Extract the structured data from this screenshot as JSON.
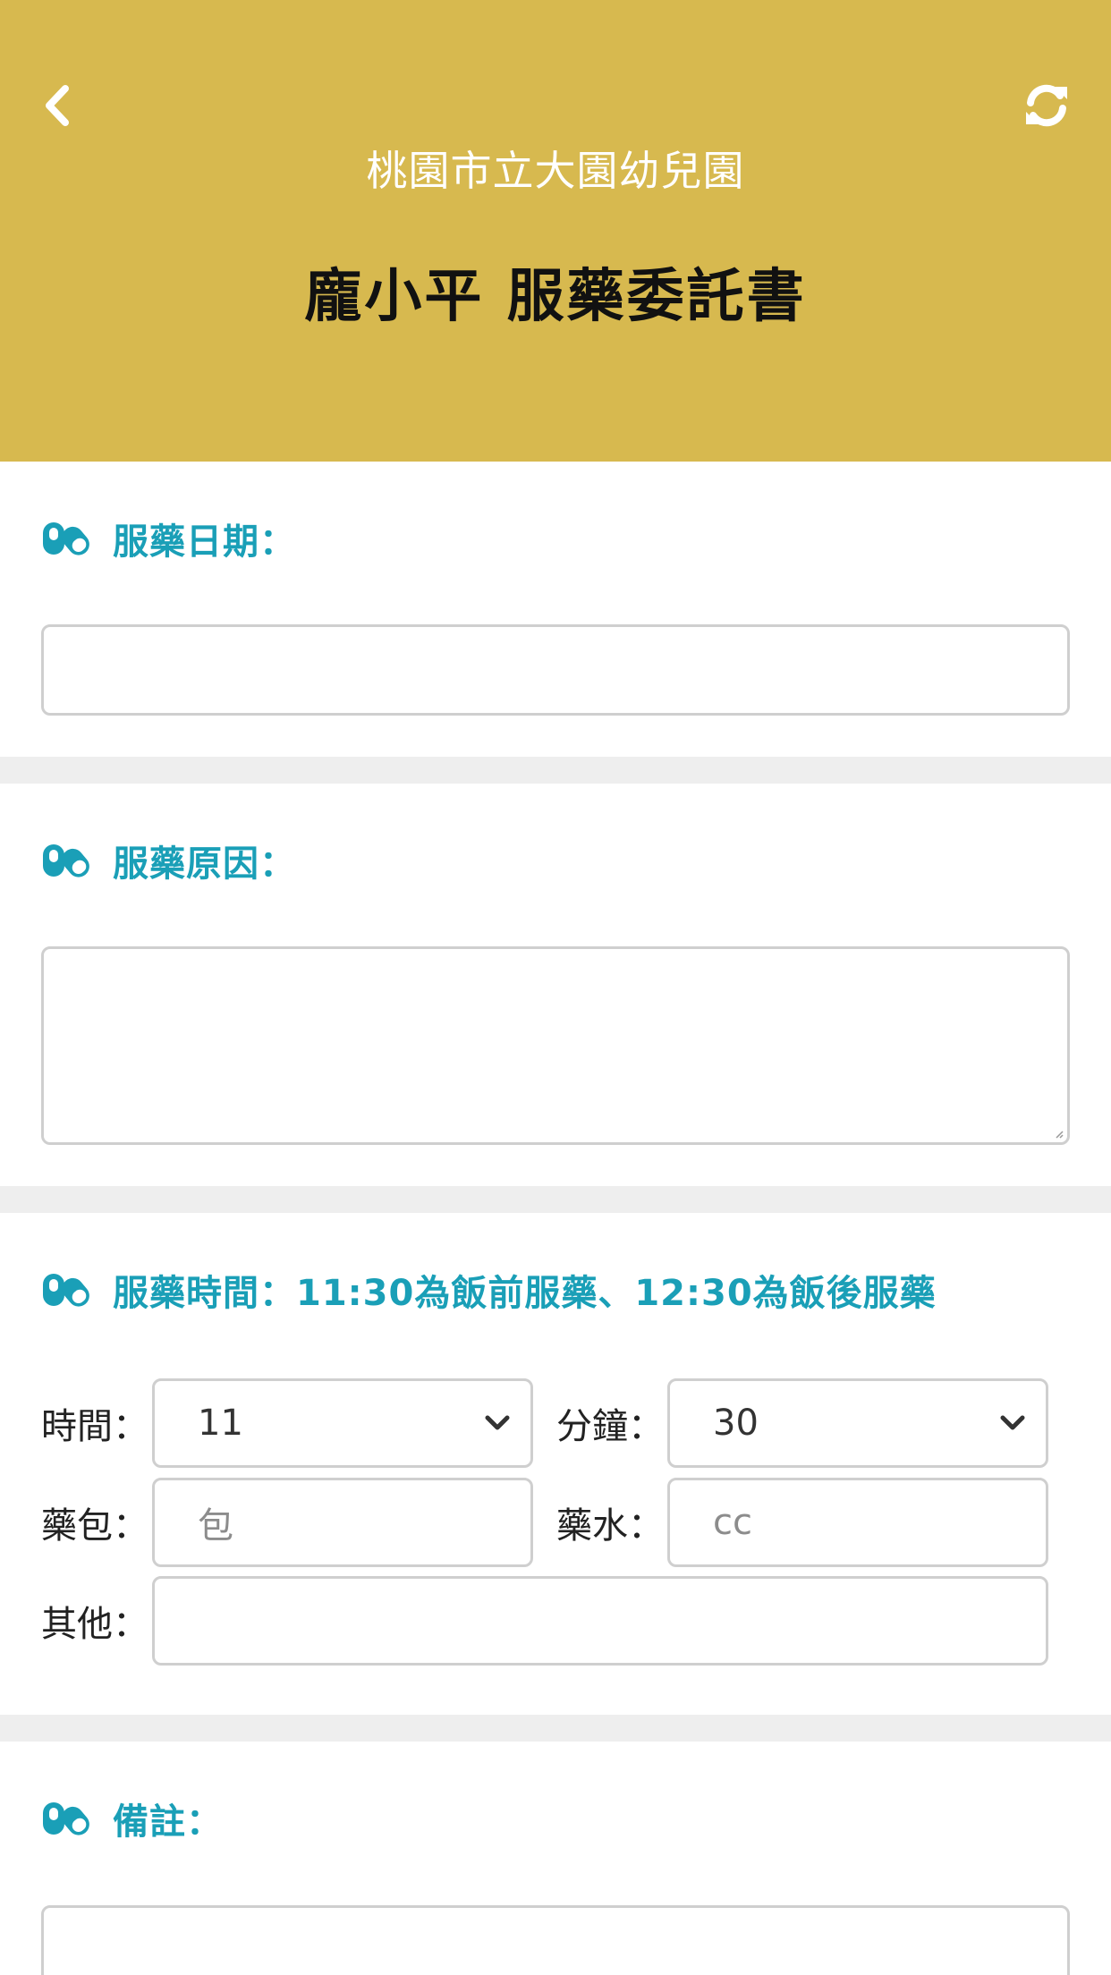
{
  "header": {
    "school_name": "桃園市立大園幼兒園",
    "title": "龐小平 服藥委託書",
    "background_color": "#d7b94f",
    "back_icon": "chevron-left-icon",
    "refresh_icon": "refresh-icon"
  },
  "sections": {
    "date": {
      "label": "服藥日期：",
      "value": ""
    },
    "reason": {
      "label": "服藥原因：",
      "value": ""
    },
    "time": {
      "label": "服藥時間：11:30為飯前服藥、12:30為飯後服藥",
      "hour_label": "時間：",
      "hour_value": "11",
      "minute_label": "分鐘：",
      "minute_value": "30",
      "packet_label": "藥包：",
      "packet_placeholder": "包",
      "liquid_label": "藥水：",
      "liquid_placeholder": "cc",
      "other_label": "其他：",
      "other_value": ""
    },
    "remarks": {
      "label": "備註：",
      "value": ""
    }
  },
  "colors": {
    "accent": "#1a9fb7",
    "divider": "#eeeeee",
    "border": "#cfcfcf"
  },
  "section_icon": "pill-icon"
}
